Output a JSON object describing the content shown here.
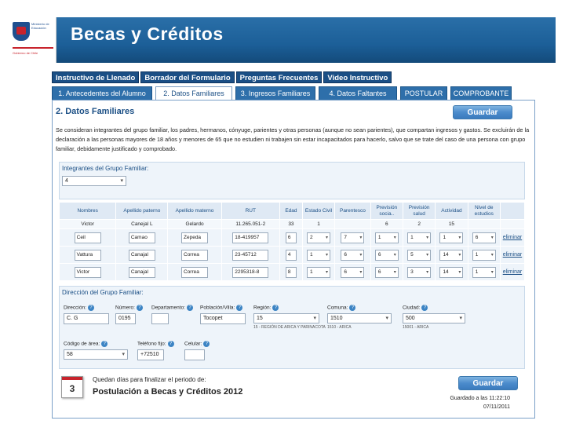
{
  "header": {
    "title": "Becas y Créditos",
    "logo_lines": [
      "Ministerio de",
      "Educación"
    ],
    "logo_footer": "Gobierno de Chile"
  },
  "topnav": [
    "Instructivo de Llenado",
    "Borrador del Formulario",
    "Preguntas Frecuentes",
    "Video Instructivo"
  ],
  "steps": [
    {
      "label": "1. Antecedentes del Alumno",
      "active": false
    },
    {
      "label": "2. Datos Familiares",
      "active": true
    },
    {
      "label": "3. Ingresos Familiares",
      "active": false
    },
    {
      "label": "4. Datos Faltantes",
      "active": false
    },
    {
      "label": "POSTULAR",
      "active": false
    },
    {
      "label": "COMPROBANTE",
      "active": false
    }
  ],
  "section_title": "2. Datos Familiares",
  "save_label": "Guardar",
  "description": "Se consideran integrantes del grupo familiar, los padres, hermanos, cónyuge, parientes y otras personas (aunque no sean parientes), que compartan ingresos y gastos. Se excluirán de la declaración a las personas mayores de 18 años y menores de 65 que no estudien ni trabajen sin estar incapacitados para hacerlo, salvo que se trate del caso de una persona con grupo familiar, debidamente justificado y comprobado.",
  "integrantes": {
    "label": "Integrantes del Grupo Familiar:",
    "value": "4"
  },
  "table": {
    "headers": [
      "Nombres",
      "Apellido paterno",
      "Apellido materno",
      "RUT",
      "Edad",
      "Estado Civil",
      "Parentesco",
      "Previsión socia..",
      "Previsión salud",
      "Actividad",
      "Nivel de estudios",
      ""
    ],
    "first_row": [
      "Victor",
      "Canejal L",
      "Gelardo",
      "11.265.051-2",
      "33",
      "1",
      "",
      "6",
      "2",
      "15",
      "",
      ""
    ],
    "rows": [
      {
        "nombre": "Ceil",
        "paterno": "Camao",
        "materno": "Zepeda",
        "rut": "18-419957",
        "edad": "6",
        "estado": "2",
        "parentesco": "7",
        "prev_social": "1",
        "prev_salud": "1",
        "actividad": "1",
        "estudios": "6",
        "action": "eliminar"
      },
      {
        "nombre": "Vattura",
        "paterno": "Canajal",
        "materno": "Correa",
        "rut": "23-45712",
        "edad": "4",
        "estado": "1",
        "parentesco": "6",
        "prev_social": "6",
        "prev_salud": "5",
        "actividad": "14",
        "estudios": "1",
        "action": "eliminar"
      },
      {
        "nombre": "Victor",
        "paterno": "Canajal",
        "materno": "Correa",
        "rut": "2295318-8",
        "edad": "8",
        "estado": "1",
        "parentesco": "6",
        "prev_social": "6",
        "prev_salud": "3",
        "actividad": "14",
        "estudios": "1",
        "action": "eliminar"
      }
    ]
  },
  "direccion": {
    "title": "Dirección del Grupo Familiar:",
    "labels": {
      "direccion": "Dirección:",
      "numero": "Número:",
      "depto": "Departamento:",
      "poblacion": "Población/Villa:",
      "region": "Región:",
      "comuna": "Comuna:",
      "ciudad": "Ciudad:",
      "codigo_area": "Código de área:",
      "telefono": "Teléfono fijo:",
      "celular": "Celular:"
    },
    "values": {
      "direccion": "C. G",
      "numero": "0195",
      "depto": "",
      "poblacion": "Tocopet",
      "region": "15",
      "comuna": "1510",
      "ciudad": "500",
      "codigo_area": "58",
      "telefono": "+72510",
      "celular": ""
    },
    "region_hint": "15 - REGIÓN DE ARICA Y PARINACOTA",
    "comuna_hint": "1510 - ARICA",
    "ciudad_hint": "15001 - ARICA"
  },
  "footer": {
    "days": "3",
    "line1": "Quedan   días para finalizar el periodo de:",
    "line2": "Postulación a Becas y Créditos 2012",
    "saved_line1": "Guardado a las 11:22:10",
    "saved_line2": "07/11/2011"
  },
  "colors": {
    "brand_blue": "#1b4f85",
    "header_blue": "#1c5f98",
    "accent_red": "#c8232c"
  }
}
